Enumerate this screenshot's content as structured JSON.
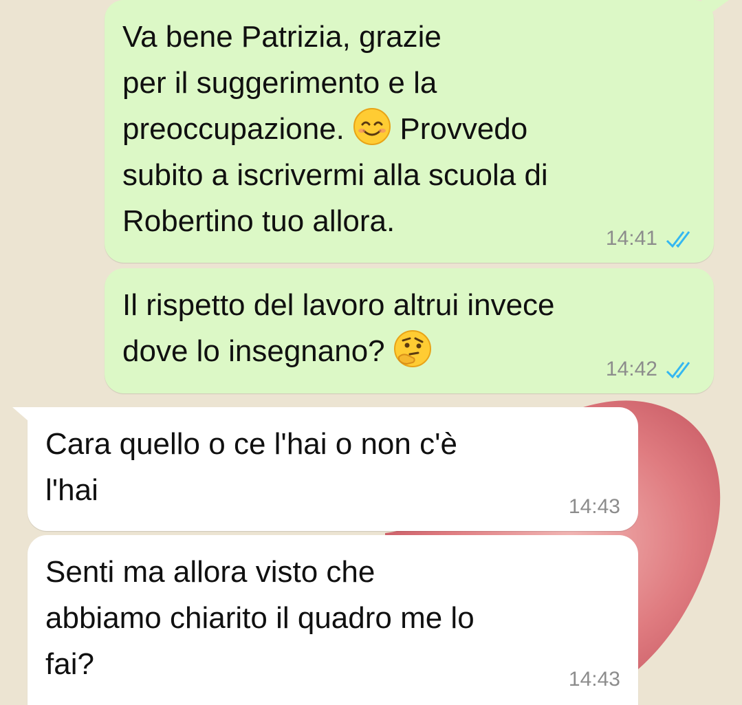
{
  "chat": {
    "messages": [
      {
        "direction": "outgoing",
        "lines": [
          "Va bene Patrizia, grazie",
          "per il suggerimento e la"
        ],
        "line3_before": "preoccupazione. ",
        "emoji": "smiling-face-emoji",
        "line3_after": " Provvedo",
        "lines_end": [
          "subito a iscrivermi alla scuola di",
          "Robertino tuo allora."
        ],
        "time": "14:41",
        "status": "read"
      },
      {
        "direction": "outgoing",
        "line1": "Il rispetto del lavoro altrui invece",
        "line2_before": "dove lo insegnano? ",
        "emoji": "thinking-face-emoji",
        "time": "14:42",
        "status": "read"
      },
      {
        "direction": "incoming",
        "text": "Cara quello o ce l'hai o non c'è\nl'hai",
        "time": "14:43"
      },
      {
        "direction": "incoming",
        "text": "Senti ma allora visto che\nabbiamo chiarito il quadro me lo\nfai?",
        "time": "14:43"
      }
    ]
  },
  "colors": {
    "outgoing_bubble": "#dcf8c6",
    "incoming_bubble": "#ffffff",
    "read_ticks": "#34b7f1",
    "wallpaper": "#ece4d2",
    "wallpaper_heart": "#d8606a"
  }
}
